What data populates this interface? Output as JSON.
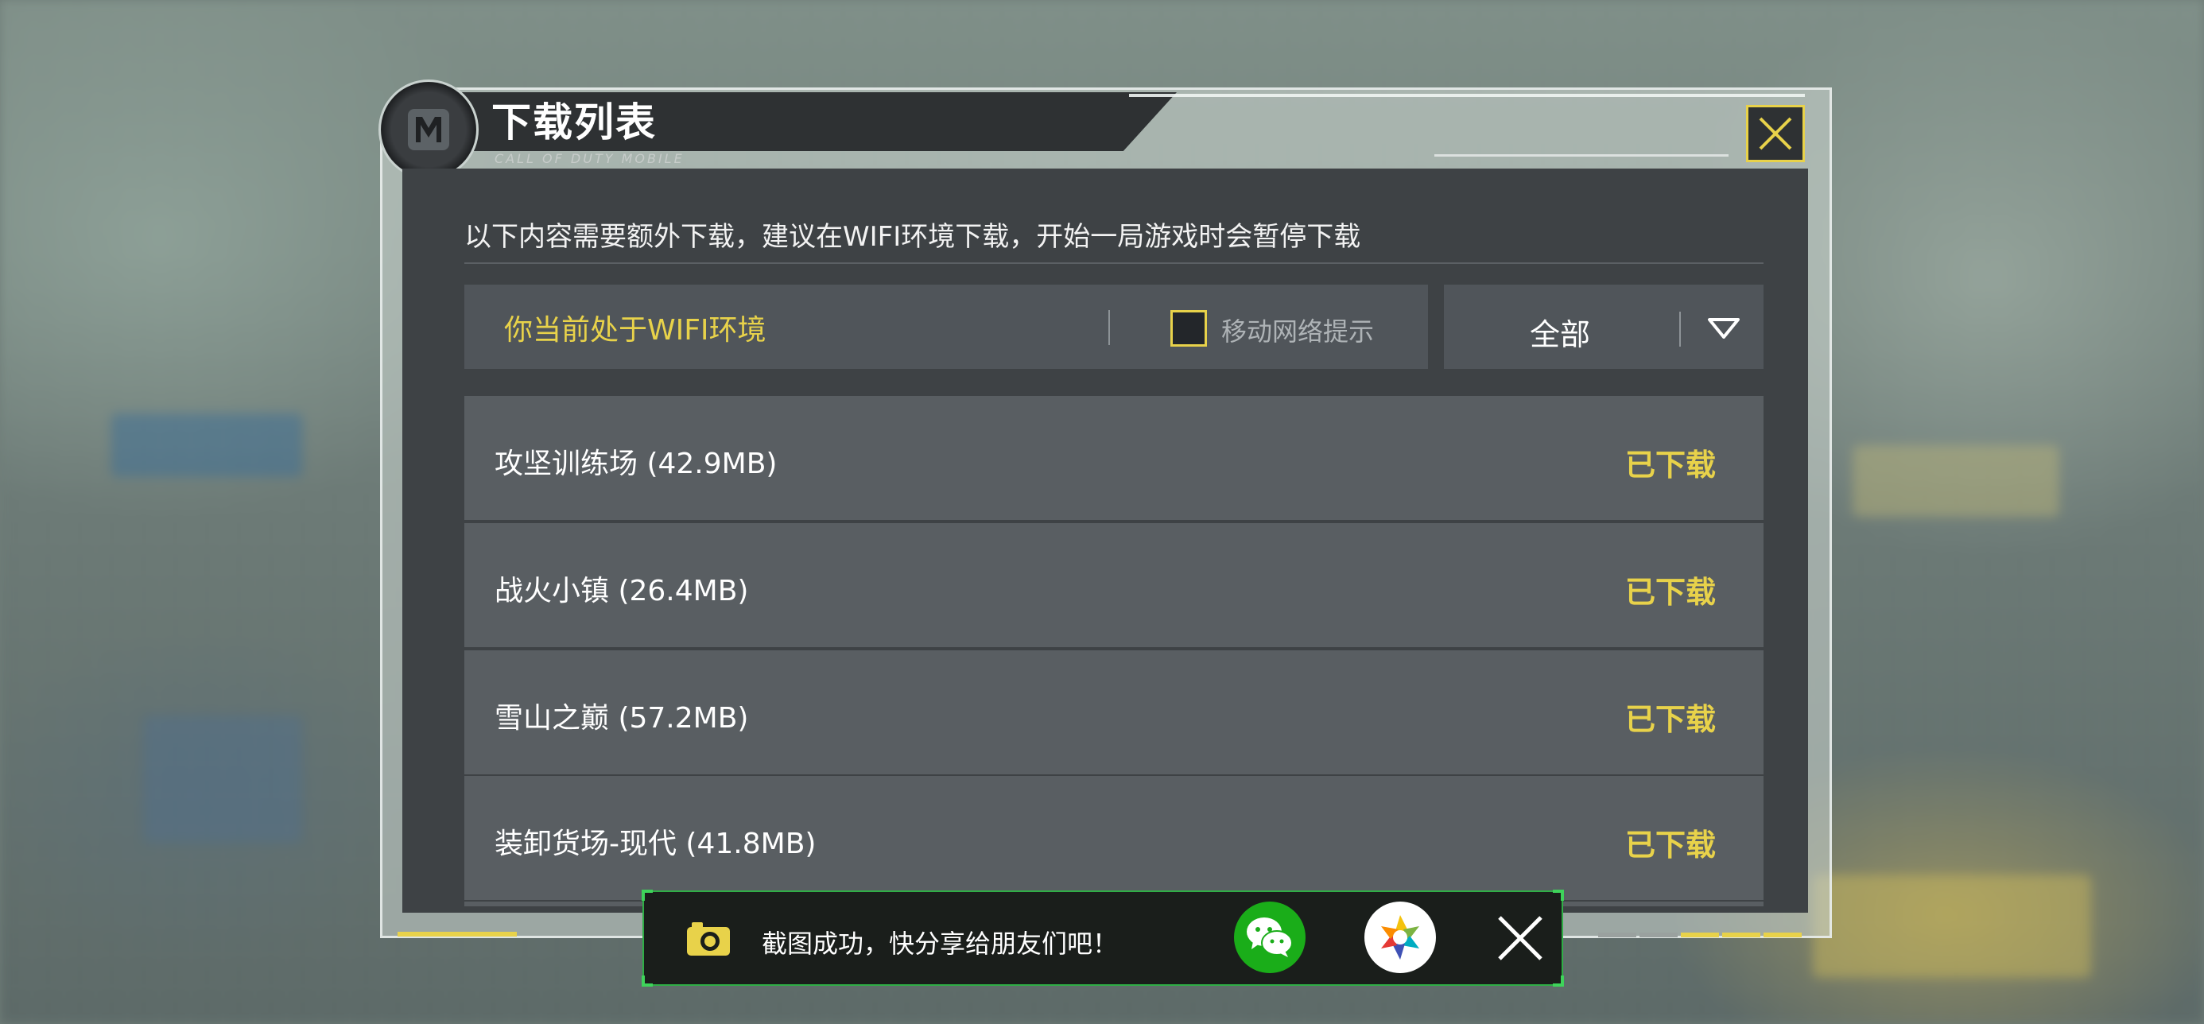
{
  "dialog": {
    "title": "下载列表",
    "subtitle": "CALL OF DUTY MOBILE",
    "close_icon": "close-x-icon"
  },
  "notice": "以下内容需要额外下载，建议在WIFI环境下载，开始一局游戏时会暂停下载",
  "network": {
    "status": "你当前处于WIFI环境",
    "mobile_prompt_label": "移动网络提示",
    "mobile_prompt_checked": false
  },
  "filter": {
    "selected": "全部",
    "icon": "triangle-down-icon"
  },
  "downloads": [
    {
      "name": "攻坚训练场 (42.9MB)",
      "status": "已下载"
    },
    {
      "name": "战火小镇 (26.4MB)",
      "status": "已下载"
    },
    {
      "name": "雪山之巅 (57.2MB)",
      "status": "已下载"
    },
    {
      "name": "装卸货场-现代 (41.8MB)",
      "status": "已下载"
    }
  ],
  "toast": {
    "message": "截图成功，快分享给朋友们吧！",
    "icons": [
      "camera-icon",
      "wechat-icon",
      "moments-icon",
      "close-x-icon"
    ]
  },
  "colors": {
    "accent_yellow": "#e8d24a",
    "panel_bg": "#3e4245",
    "row_bg": "#595e62",
    "toast_border": "#2fae46",
    "wechat_green": "#1aad19"
  }
}
